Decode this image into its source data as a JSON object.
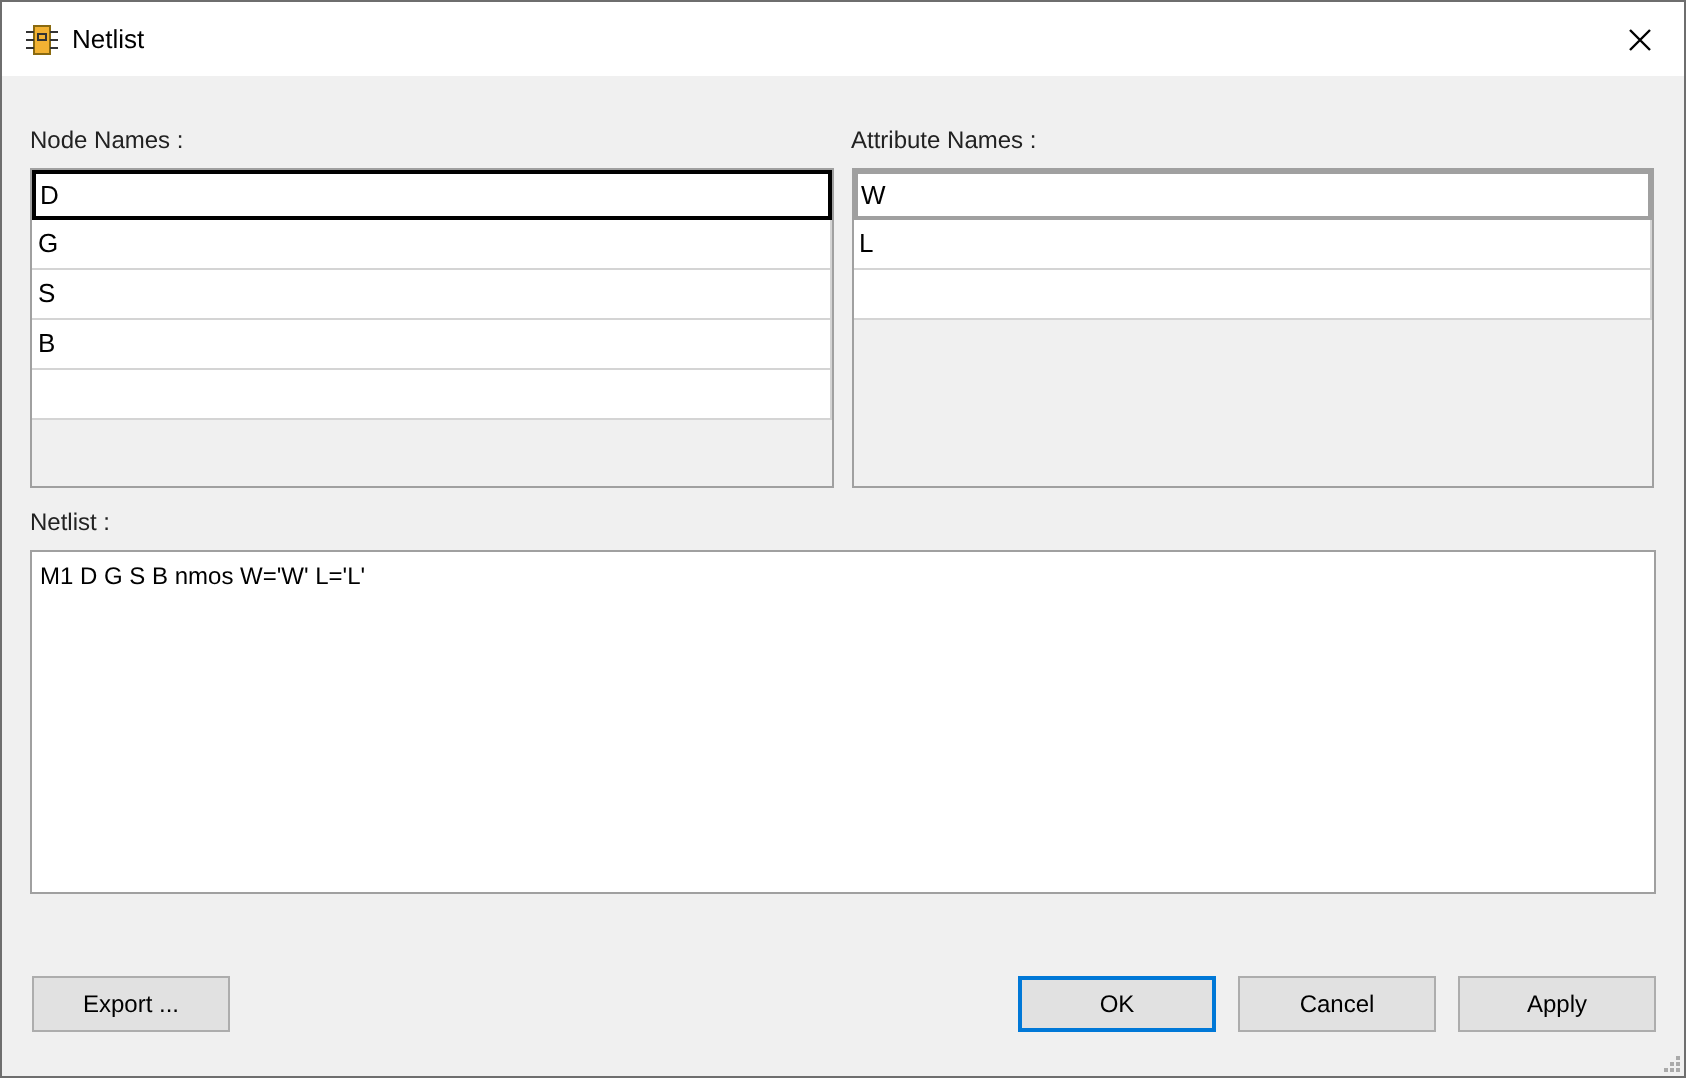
{
  "window": {
    "title": "Netlist"
  },
  "node_names": {
    "label": "Node Names :",
    "focused": true,
    "new_row": true,
    "rows": [
      {
        "value": "D",
        "selected": true
      },
      {
        "value": "G",
        "selected": false
      },
      {
        "value": "S",
        "selected": false
      },
      {
        "value": "B",
        "selected": false
      }
    ]
  },
  "attribute_names": {
    "label": "Attribute Names :",
    "focused": false,
    "new_row": true,
    "rows": [
      {
        "value": "W",
        "selected": true
      },
      {
        "value": "L",
        "selected": false
      }
    ]
  },
  "netlist": {
    "label": "Netlist :",
    "value": "M1 D G S B nmos W='W' L='L'"
  },
  "buttons": [
    {
      "label": "Export ...",
      "default": false
    },
    {
      "label": "OK",
      "default": true
    },
    {
      "label": "Cancel",
      "default": false
    },
    {
      "label": "Apply",
      "default": false
    }
  ]
}
